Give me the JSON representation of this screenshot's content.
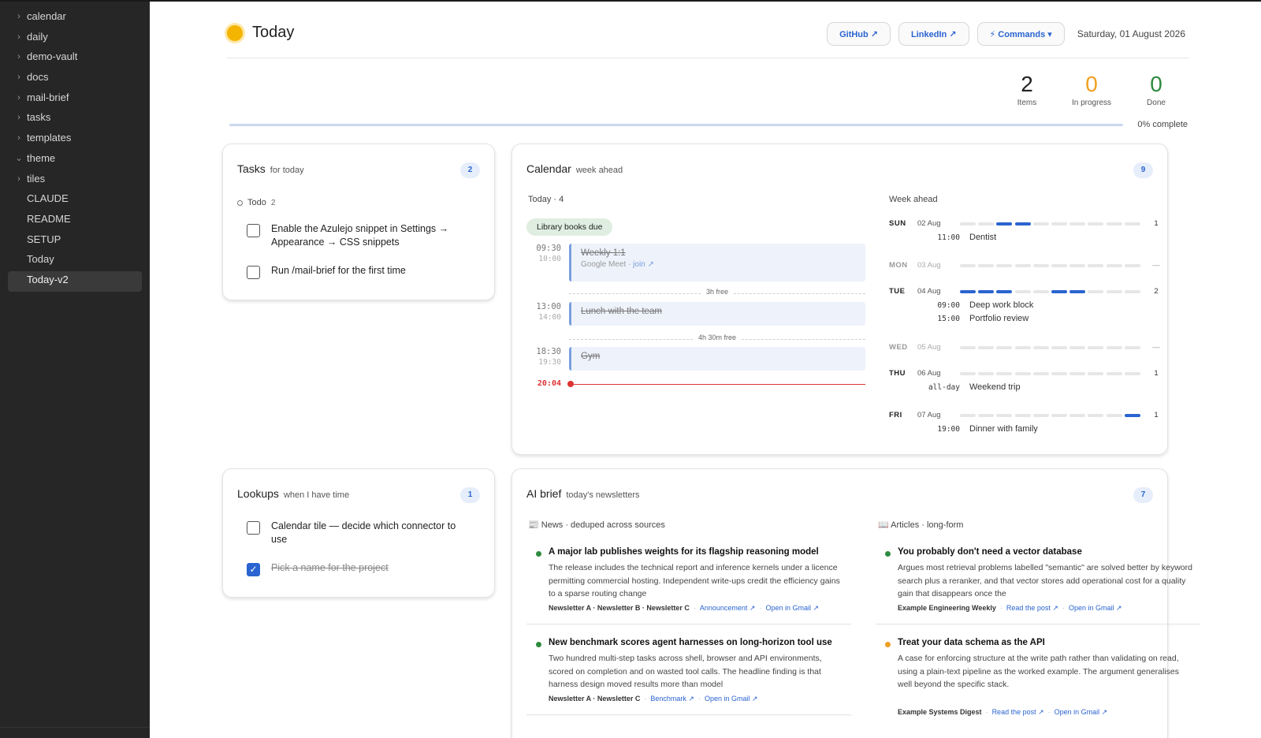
{
  "sidebar": {
    "folders": [
      "calendar",
      "daily",
      "demo-vault",
      "docs",
      "mail-brief",
      "tasks",
      "templates",
      "theme",
      "tiles"
    ],
    "files": [
      "CLAUDE",
      "README",
      "SETUP",
      "Today",
      "Today-v2"
    ]
  },
  "header": {
    "title": "Today",
    "github": "GitHub ↗",
    "linkedin": "LinkedIn ↗",
    "commands": "⚡ Commands ▾",
    "date": "Saturday, 01 August 2026"
  },
  "stats": {
    "items_num": "2",
    "items_lbl": "Items",
    "progress_num": "0",
    "progress_lbl": "In progress",
    "done_num": "0",
    "done_lbl": "Done",
    "complete_fraction": 0,
    "complete_lbl": "0% complete",
    "colors": {
      "items": "#222222",
      "progress": "#f0a020",
      "done": "#2e8b3e"
    }
  },
  "tasks_card": {
    "title": "Tasks",
    "sub": "for today",
    "badge": "2",
    "group": "Todo",
    "group_count": "2",
    "items": [
      {
        "text": "Enable the Azulejo snippet in Settings → Appearance → CSS snippets",
        "done": false
      },
      {
        "text": "Run /mail-brief for the first time",
        "done": false
      }
    ]
  },
  "lookups_card": {
    "title": "Lookups",
    "sub": "when I have time",
    "badge": "1",
    "items": [
      {
        "text": "Calendar tile — decide which connector to use",
        "done": false
      },
      {
        "text": "Pick a name for the project",
        "done": true
      }
    ]
  },
  "calendar": {
    "title": "Calendar",
    "sub": "week ahead",
    "badge": "9",
    "today_label": "Today · 4",
    "allday_chip": "Library books due",
    "events": [
      {
        "start": "09:30",
        "end": "10:00",
        "name": "Weekly 1:1",
        "meta": "Google Meet · ",
        "link": "join ↗"
      },
      {
        "start": "13:00",
        "end": "14:00",
        "name": "Lunch with the team"
      },
      {
        "start": "18:30",
        "end": "19:30",
        "name": "Gym"
      }
    ],
    "gaps": [
      "3h free",
      "4h 30m free"
    ],
    "now": "20:04",
    "week_label": "Week ahead",
    "days": [
      {
        "day": "SUN",
        "date": "02 Aug",
        "count": "1",
        "slots": [
          0,
          0,
          1,
          1,
          0,
          0,
          0,
          0,
          0,
          0
        ],
        "events": [
          {
            "t": "11:00",
            "n": "Dentist"
          }
        ]
      },
      {
        "day": "MON",
        "date": "03 Aug",
        "count": "—",
        "slots": [
          0,
          0,
          0,
          0,
          0,
          0,
          0,
          0,
          0,
          0
        ],
        "events": []
      },
      {
        "day": "TUE",
        "date": "04 Aug",
        "count": "2",
        "slots": [
          1,
          1,
          1,
          0,
          0,
          1,
          1,
          0,
          0,
          0
        ],
        "events": [
          {
            "t": "09:00",
            "n": "Deep work block"
          },
          {
            "t": "15:00",
            "n": "Portfolio review"
          }
        ]
      },
      {
        "day": "WED",
        "date": "05 Aug",
        "count": "—",
        "slots": [
          0,
          0,
          0,
          0,
          0,
          0,
          0,
          0,
          0,
          0
        ],
        "events": []
      },
      {
        "day": "THU",
        "date": "06 Aug",
        "count": "1",
        "slots": [
          0,
          0,
          0,
          0,
          0,
          0,
          0,
          0,
          0,
          0
        ],
        "events": [
          {
            "t": "all-day",
            "n": "Weekend trip"
          }
        ]
      },
      {
        "day": "FRI",
        "date": "07 Aug",
        "count": "1",
        "slots": [
          0,
          0,
          0,
          0,
          0,
          0,
          0,
          0,
          0,
          1
        ],
        "events": [
          {
            "t": "19:00",
            "n": "Dinner with family"
          }
        ]
      }
    ]
  },
  "brief": {
    "title": "AI brief",
    "sub": "today's newsletters",
    "badge": "7",
    "news_label": "📰 News · deduped across sources",
    "articles_label": "📖 Articles · long-form",
    "news": [
      {
        "title": "A major lab publishes weights for its flagship reasoning model",
        "body": "The release includes the technical report and inference kernels under a licence permitting commercial hosting. Independent write-ups credit the efficiency gains to a sparse routing change",
        "sources": "Newsletter A · Newsletter B · Newsletter C",
        "link1": "Announcement ↗",
        "link2": "Open in Gmail ↗",
        "color": "#2e8b3e"
      },
      {
        "title": "New benchmark scores agent harnesses on long-horizon tool use",
        "body": "Two hundred multi-step tasks across shell, browser and API environments, scored on completion and on wasted tool calls. The headline finding is that harness design moved results more than model",
        "sources": "Newsletter A · Newsletter C",
        "link1": "Benchmark ↗",
        "link2": "Open in Gmail ↗",
        "color": "#2e8b3e"
      }
    ],
    "articles": [
      {
        "title": "You probably don't need a vector database",
        "body": "Argues most retrieval problems labelled \"semantic\" are solved better by keyword search plus a reranker, and that vector stores add operational cost for a quality gain that disappears once the",
        "sources": "Example Engineering Weekly",
        "link1": "Read the post ↗",
        "link2": "Open in Gmail ↗",
        "color": "#2e8b3e"
      },
      {
        "title": "Treat your data schema as the API",
        "body": "A case for enforcing structure at the write path rather than validating on read, using a plain-text pipeline as the worked example. The argument generalises well beyond the specific stack.",
        "sources": "Example Systems Digest",
        "link1": "Read the post ↗",
        "link2": "Open in Gmail ↗",
        "color": "#f0a020"
      }
    ]
  }
}
